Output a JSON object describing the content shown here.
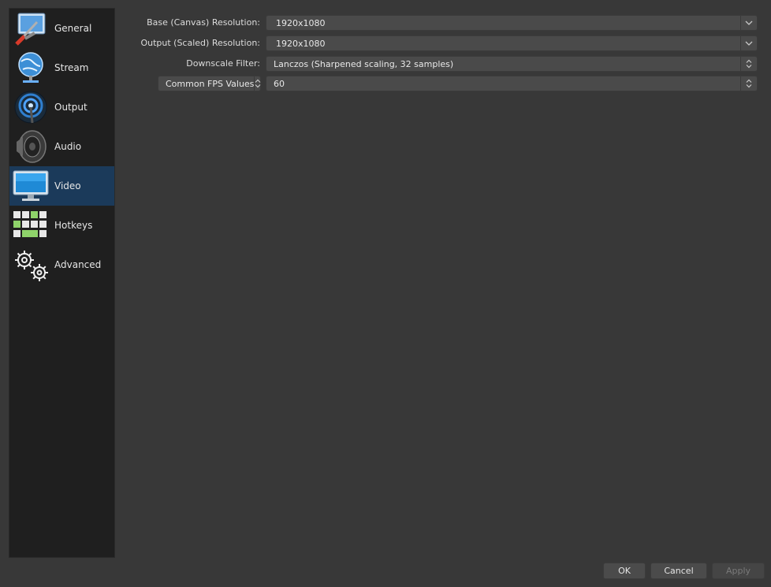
{
  "sidebar": {
    "items": [
      {
        "label": "General",
        "icon": "general-icon",
        "selected": false
      },
      {
        "label": "Stream",
        "icon": "stream-globe-icon",
        "selected": false
      },
      {
        "label": "Output",
        "icon": "output-broadcast-icon",
        "selected": false
      },
      {
        "label": "Audio",
        "icon": "audio-speaker-icon",
        "selected": false
      },
      {
        "label": "Video",
        "icon": "video-monitor-icon",
        "selected": true
      },
      {
        "label": "Hotkeys",
        "icon": "hotkeys-keyboard-icon",
        "selected": false
      },
      {
        "label": "Advanced",
        "icon": "advanced-gears-icon",
        "selected": false
      }
    ]
  },
  "video": {
    "base_resolution": {
      "label": "Base (Canvas) Resolution:",
      "value": "1920x1080"
    },
    "output_resolution": {
      "label": "Output (Scaled) Resolution:",
      "value": "1920x1080"
    },
    "downscale_filter": {
      "label": "Downscale Filter:",
      "value": "Lanczos (Sharpened scaling, 32 samples)"
    },
    "fps": {
      "mode": "Common FPS Values",
      "value": "60"
    }
  },
  "buttons": {
    "ok": "OK",
    "cancel": "Cancel",
    "apply": "Apply"
  },
  "colors": {
    "selected_bg": "#1b3a5a",
    "window_bg": "#383838",
    "sidebar_bg": "#1f1f1f"
  }
}
